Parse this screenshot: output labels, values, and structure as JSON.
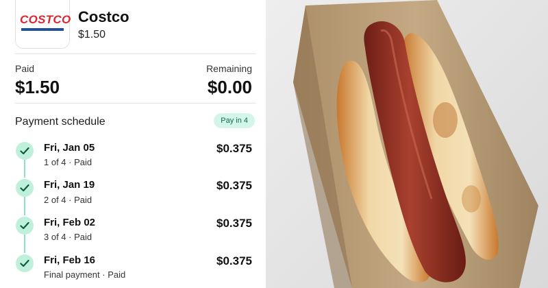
{
  "merchant": {
    "logo_text": "COSTCO",
    "name": "Costco",
    "amount": "$1.50"
  },
  "summary": {
    "paid_label": "Paid",
    "paid_value": "$1.50",
    "remaining_label": "Remaining",
    "remaining_value": "$0.00"
  },
  "schedule": {
    "title": "Payment schedule",
    "badge": "Pay in 4",
    "payments": [
      {
        "date": "Fri, Jan 05",
        "status": "1 of 4 · Paid",
        "amount": "$0.375"
      },
      {
        "date": "Fri, Jan 19",
        "status": "2 of 4 · Paid",
        "amount": "$0.375"
      },
      {
        "date": "Fri, Feb 02",
        "status": "3 of 4 · Paid",
        "amount": "$0.375"
      },
      {
        "date": "Fri, Feb 16",
        "status": "Final payment · Paid",
        "amount": "$0.375"
      }
    ]
  },
  "colors": {
    "brand_red": "#d9262f",
    "brand_blue": "#1f4fa0",
    "check_bg": "#bff0dc",
    "check_mark": "#0f5a40",
    "badge_bg": "#d3f5ea",
    "badge_text": "#0f6b4e"
  },
  "icons": [
    "check-icon"
  ]
}
